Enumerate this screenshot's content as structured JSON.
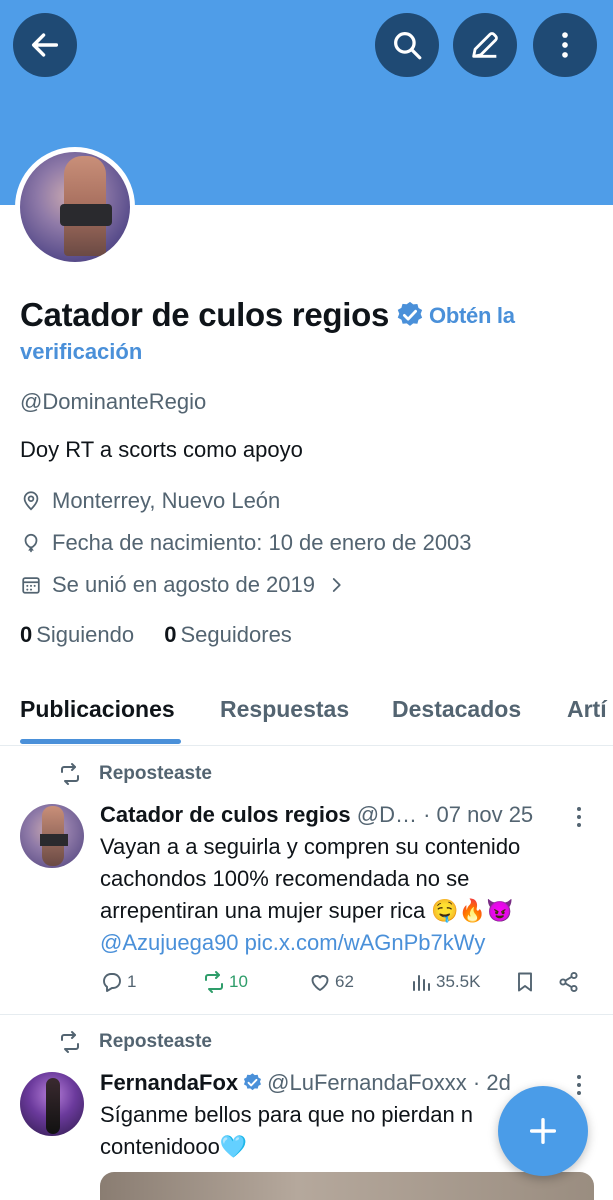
{
  "profile": {
    "name": "Catador de culos regios",
    "get_verified": "Obtén la",
    "get_verified_2": "verificación",
    "handle": "@DominanteRegio",
    "bio": "Doy RT a scorts como apoyo",
    "location": "Monterrey, Nuevo León",
    "birthdate": "Fecha de nacimiento: 10 de enero de 2003",
    "joined": "Se unió en agosto de 2019",
    "following_count": "0",
    "following_label": "Siguiendo",
    "followers_count": "0",
    "followers_label": "Seguidores"
  },
  "tabs": [
    "Publicaciones",
    "Respuestas",
    "Destacados",
    "Artí"
  ],
  "posts": [
    {
      "repost_label": "Reposteaste",
      "author": "Catador de culos regios",
      "meta": "@D… · 07 nov 25",
      "lines": [
        "Vayan a a seguirla y compren su contenido",
        "cachondos 100% recomendada no se",
        "arrepentiran una mujer super rica 🤤🔥😈"
      ],
      "link_line_a": "@Azujuega90",
      "link_line_b": "pic.x.com/wAGnPb7kWy",
      "replies": "1",
      "reposts": "10",
      "likes": "62",
      "views": "35.5K"
    },
    {
      "repost_label": "Reposteaste",
      "author": "FernandaFox",
      "meta": "@LuFernandaFoxxx · 2d",
      "lines": [
        "Síganme bellos para que no pierdan n",
        "contenidooo🩵"
      ]
    }
  ],
  "colors": {
    "banner": "#4f9de8",
    "accent": "#4a90d9",
    "repost_green": "#2e9d6a"
  },
  "icons": [
    "back-arrow-icon",
    "search-icon",
    "edit-icon",
    "more-vertical-icon",
    "verified-badge-icon",
    "location-pin-icon",
    "balloon-icon",
    "calendar-icon",
    "chevron-right-icon",
    "repost-icon",
    "reply-icon",
    "like-icon",
    "views-icon",
    "bookmark-icon",
    "share-icon",
    "plus-icon"
  ]
}
